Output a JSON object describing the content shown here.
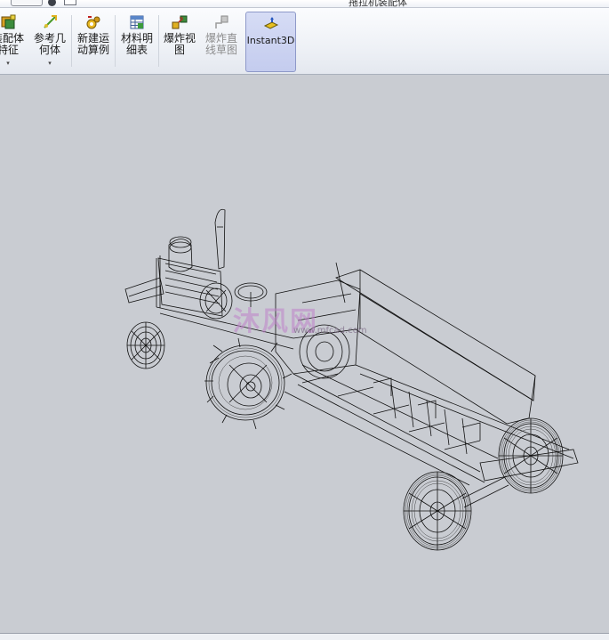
{
  "titlebar": {
    "document_title": "拖拉机装配体"
  },
  "ribbon": {
    "buttons": [
      {
        "label_line1": "装配体",
        "label_line2": "特征",
        "icon": "assembly-features-icon",
        "has_dropdown": true
      },
      {
        "label_line1": "参考几",
        "label_line2": "何体",
        "icon": "reference-geometry-icon",
        "has_dropdown": true
      },
      {
        "label_line1": "新建运",
        "label_line2": "动算例",
        "icon": "new-motion-study-icon"
      },
      {
        "label_line1": "材料明",
        "label_line2": "细表",
        "icon": "bill-of-materials-icon"
      },
      {
        "label_line1": "爆炸视",
        "label_line2": "图",
        "icon": "exploded-view-icon"
      },
      {
        "label_line1": "爆炸直",
        "label_line2": "线草图",
        "icon": "explode-line-sketch-icon",
        "disabled": true
      },
      {
        "label_line1": "Instant3D",
        "label_line2": "",
        "icon": "instant3d-icon",
        "active": true
      }
    ],
    "dropdown_glyph": "▾"
  },
  "view_toolbar": {
    "tools": [
      "zoom-to-fit-icon",
      "zoom-area-icon",
      "previous-view-icon",
      "section-view-icon",
      "view-orientation-icon",
      "display-style-icon",
      "hide-show-items-icon",
      "edit-appearance-icon",
      "apply-scene-icon",
      "view-settings-icon"
    ]
  },
  "viewport": {
    "watermark": "沐风网",
    "watermark_sub": "www.mfcad.com",
    "background_color": "#c9ccd2",
    "model_name": "tractor-with-seeder-wireframe"
  }
}
